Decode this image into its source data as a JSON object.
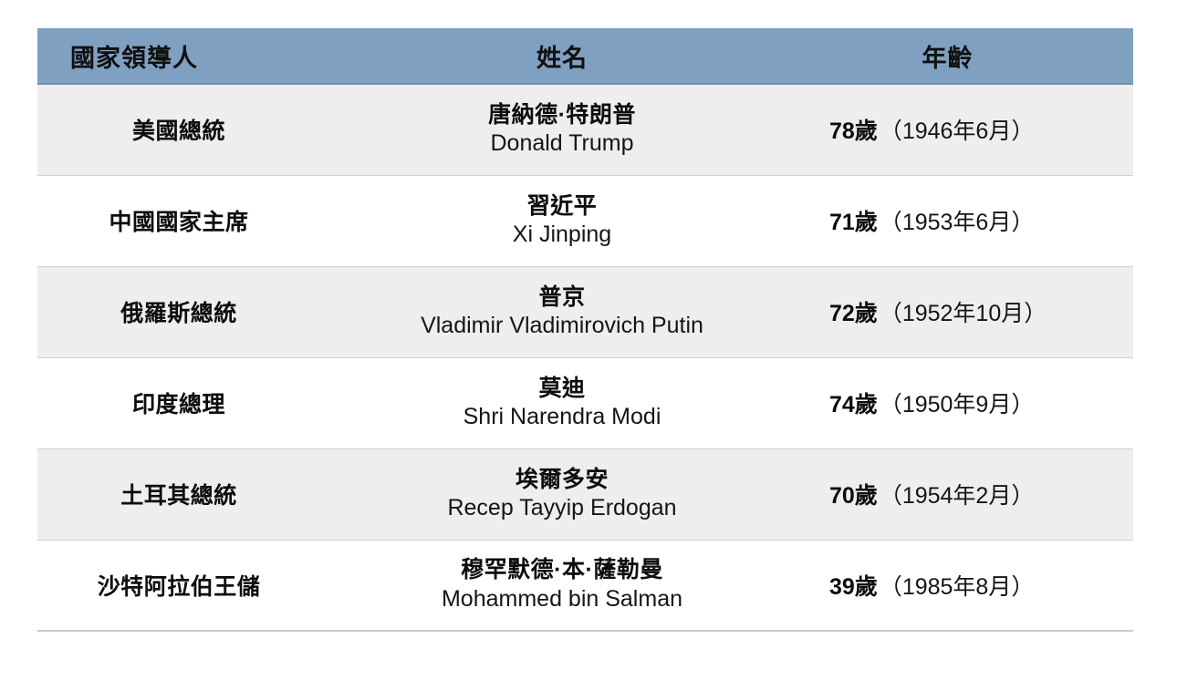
{
  "table": {
    "columns": [
      {
        "key": "role",
        "label": "國家領導人"
      },
      {
        "key": "name",
        "label": "姓名"
      },
      {
        "key": "age",
        "label": "年齡"
      }
    ],
    "header_background": "#7fa0c0",
    "row_shade_background": "#eeeeee",
    "row_plain_background": "#ffffff",
    "rows": [
      {
        "role": "美國總統",
        "name_cn": "唐納德·特朗普",
        "name_en": "Donald Trump",
        "age": "78歲",
        "born": "（1946年6月）"
      },
      {
        "role": "中國國家主席",
        "name_cn": "習近平",
        "name_en": "Xi Jinping",
        "age": "71歲",
        "born": "（1953年6月）"
      },
      {
        "role": "俄羅斯總統",
        "name_cn": "普京",
        "name_en": "Vladimir Vladimirovich Putin",
        "age": "72歲",
        "born": "（1952年10月）"
      },
      {
        "role": "印度總理",
        "name_cn": "莫迪",
        "name_en": "Shri Narendra Modi",
        "age": "74歲",
        "born": "（1950年9月）"
      },
      {
        "role": "土耳其總統",
        "name_cn": "埃爾多安",
        "name_en": "Recep Tayyip Erdogan",
        "age": "70歲",
        "born": "（1954年2月）"
      },
      {
        "role": "沙特阿拉伯王儲",
        "name_cn": "穆罕默德·本·薩勒曼",
        "name_en": "Mohammed bin Salman",
        "age": "39歲",
        "born": "（1985年8月）"
      }
    ]
  }
}
